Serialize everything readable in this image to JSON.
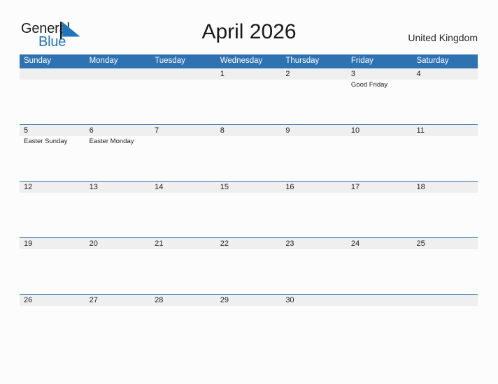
{
  "logo": {
    "text_primary": "General",
    "text_secondary": "Blue",
    "flag_icon": "triangle-flag-icon",
    "primary_color": "#1c1c1c",
    "secondary_color": "#1f74bd"
  },
  "header": {
    "title": "April 2026",
    "country": "United Kingdom"
  },
  "theme": {
    "header_blue": "#2e72b2",
    "daynum_band": "#efefef",
    "page_background": "#fcfcfc",
    "text_color": "#1d1d1d"
  },
  "calendar": {
    "month": "April",
    "year": "2026",
    "weekday_headers": [
      "Sunday",
      "Monday",
      "Tuesday",
      "Wednesday",
      "Thursday",
      "Friday",
      "Saturday"
    ],
    "weeks": [
      [
        {
          "day": "",
          "events": []
        },
        {
          "day": "",
          "events": []
        },
        {
          "day": "",
          "events": []
        },
        {
          "day": "1",
          "events": []
        },
        {
          "day": "2",
          "events": []
        },
        {
          "day": "3",
          "events": [
            "Good Friday"
          ]
        },
        {
          "day": "4",
          "events": []
        }
      ],
      [
        {
          "day": "5",
          "events": [
            "Easter Sunday"
          ]
        },
        {
          "day": "6",
          "events": [
            "Easter Monday"
          ]
        },
        {
          "day": "7",
          "events": []
        },
        {
          "day": "8",
          "events": []
        },
        {
          "day": "9",
          "events": []
        },
        {
          "day": "10",
          "events": []
        },
        {
          "day": "11",
          "events": []
        }
      ],
      [
        {
          "day": "12",
          "events": []
        },
        {
          "day": "13",
          "events": []
        },
        {
          "day": "14",
          "events": []
        },
        {
          "day": "15",
          "events": []
        },
        {
          "day": "16",
          "events": []
        },
        {
          "day": "17",
          "events": []
        },
        {
          "day": "18",
          "events": []
        }
      ],
      [
        {
          "day": "19",
          "events": []
        },
        {
          "day": "20",
          "events": []
        },
        {
          "day": "21",
          "events": []
        },
        {
          "day": "22",
          "events": []
        },
        {
          "day": "23",
          "events": []
        },
        {
          "day": "24",
          "events": []
        },
        {
          "day": "25",
          "events": []
        }
      ],
      [
        {
          "day": "26",
          "events": []
        },
        {
          "day": "27",
          "events": []
        },
        {
          "day": "28",
          "events": []
        },
        {
          "day": "29",
          "events": []
        },
        {
          "day": "30",
          "events": []
        },
        {
          "day": "",
          "events": []
        },
        {
          "day": "",
          "events": []
        }
      ]
    ]
  }
}
